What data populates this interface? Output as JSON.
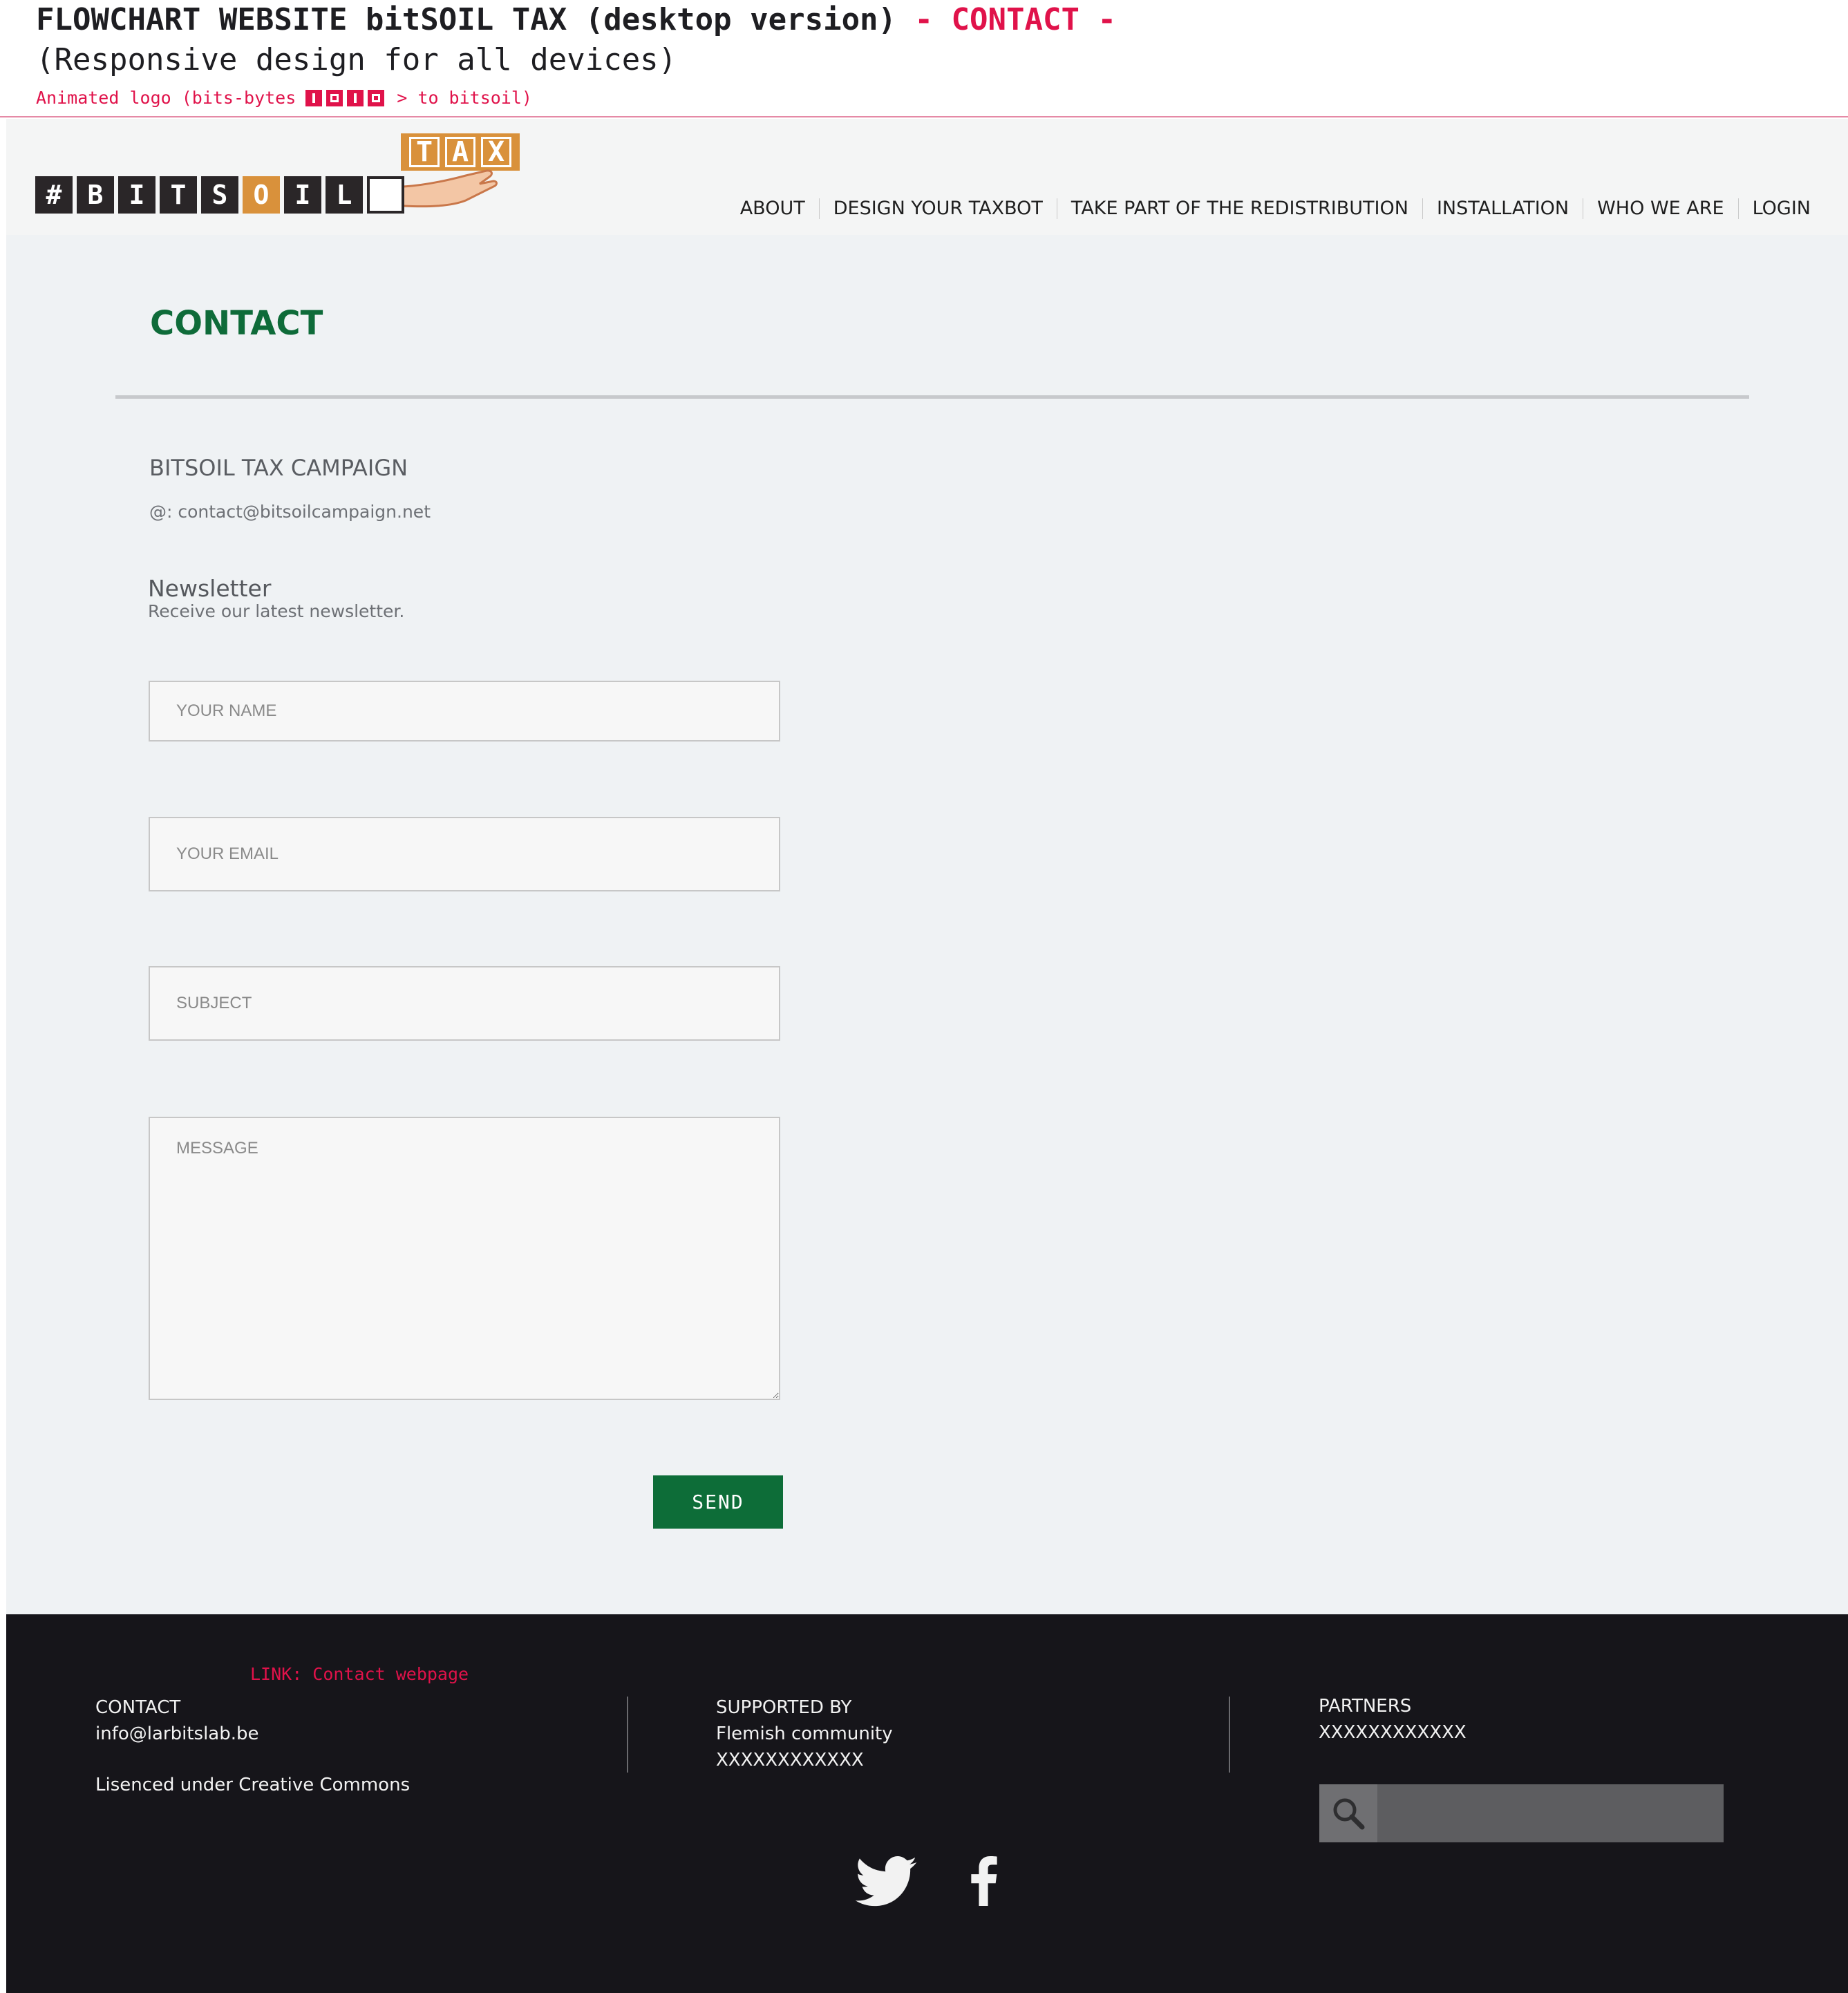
{
  "annotation": {
    "title": "FLOWCHART WEBSITE bitSOIL TAX (desktop version)",
    "title_accent": " - CONTACT -",
    "subtitle": "(Responsive design for all devices)",
    "logo_note_prefix": "Animated logo (bits-bytes",
    "logo_note_suffix": "> to bitsoil)",
    "bytes": [
      "1",
      "0",
      "1",
      "0"
    ]
  },
  "header": {
    "logo_tiles": [
      "#",
      "B",
      "I",
      "T",
      "S",
      "O",
      "I",
      "L",
      ""
    ],
    "logo_tax": [
      "T",
      "A",
      "X"
    ],
    "nav": [
      "ABOUT",
      "DESIGN YOUR TAXBOT",
      "TAKE PART OF THE REDISTRIBUTION",
      "INSTALLATION",
      "WHO WE ARE",
      "LOGIN"
    ]
  },
  "main": {
    "title": "CONTACT",
    "campaign": "BITSOIL TAX CAMPAIGN",
    "email": "@: contact@bitsoilcampaign.net",
    "newsletter_title": "Newsletter",
    "newsletter_sub": "Receive our latest newsletter.",
    "form": {
      "name_placeholder": "YOUR NAME",
      "email_placeholder": "YOUR EMAIL",
      "subject_placeholder": "SUBJECT",
      "message_placeholder": "MESSAGE",
      "send_label": "SEND"
    }
  },
  "footer": {
    "link_note": "LINK: Contact webpage",
    "contact": {
      "heading": "CONTACT",
      "email": "info@larbitslab.be",
      "license": "Lisenced under Creative Commons"
    },
    "supported": {
      "heading": "SUPPORTED BY",
      "line1": "Flemish community",
      "line2": "XXXXXXXXXXXX"
    },
    "partners": {
      "heading": "PARTNERS",
      "line1": "XXXXXXXXXXXX"
    },
    "search_placeholder": "",
    "social": [
      "twitter-icon",
      "facebook-icon"
    ]
  },
  "colors": {
    "accent_green": "#0d6d38",
    "annotation_red": "#e0124a",
    "logo_orange": "#d9913b",
    "footer_bg": "#16151a"
  }
}
